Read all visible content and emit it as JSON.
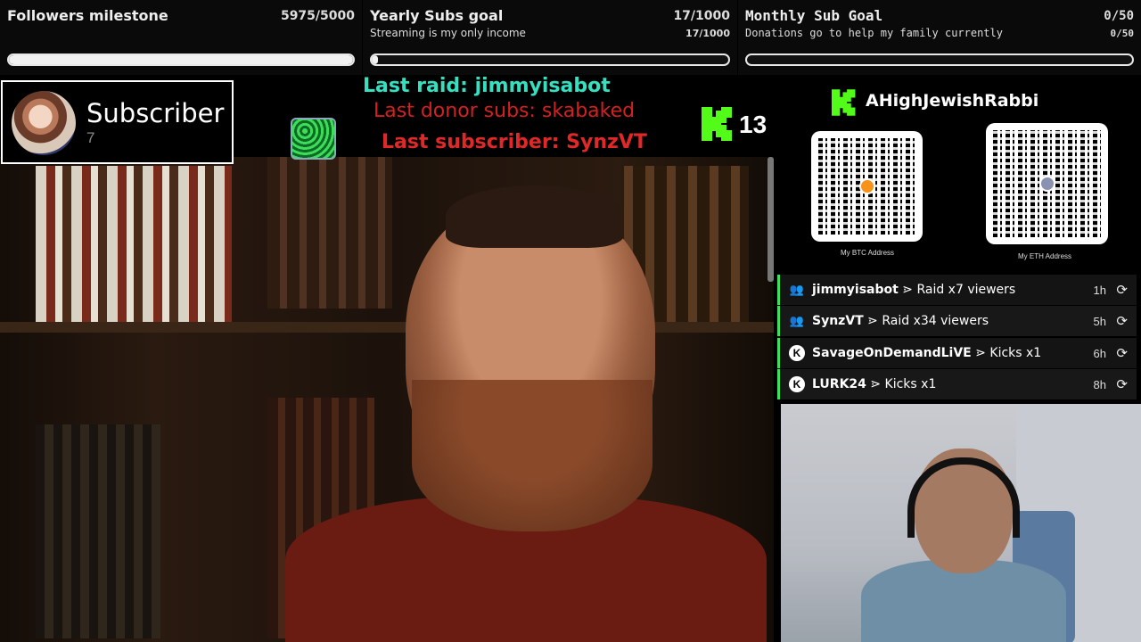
{
  "goals": [
    {
      "title": "Followers milestone",
      "count": "5975/5000",
      "subtitle": "",
      "count2": "",
      "progress": 1.0
    },
    {
      "title": "Yearly Subs goal",
      "count": "17/1000",
      "subtitle": "Streaming is my only income",
      "count2": "17/1000",
      "progress": 0.017
    },
    {
      "title": "Monthly Sub Goal",
      "count": "0/50",
      "subtitle": "Donations go to help my family currently",
      "count2": "0/50",
      "progress": 0.0
    }
  ],
  "subscriber_box": {
    "label": "Subscriber",
    "count": "7"
  },
  "last_raid": "Last raid: jimmyisabot",
  "last_donor": "Last donor subs: skabaked",
  "last_subscriber": "Last subscriber: SynzVT",
  "kick_viewers": "13",
  "channel_name": "AHighJewishRabbi",
  "qr_codes": [
    {
      "caption": "My BTC Address",
      "icon": "bitcoin-icon"
    },
    {
      "caption": "My ETH Address",
      "icon": "ethereum-icon"
    }
  ],
  "events": [
    {
      "icon": "raid-icon",
      "user": "jimmyisabot",
      "action": "⋗ Raid x7 viewers",
      "time": "1h"
    },
    {
      "icon": "raid-icon",
      "user": "SynzVT",
      "action": "⋗ Raid x34 viewers",
      "time": "5h"
    },
    {
      "icon": "kick-icon",
      "user": "SavageOnDemandLiVE",
      "action": "⋗ Kicks x1",
      "time": "6h"
    },
    {
      "icon": "kick-icon",
      "user": "LURK24",
      "action": "⋗ Kicks x1",
      "time": "8h"
    }
  ],
  "colors": {
    "kick_green": "#53fc18",
    "raid_text": "#35e0c0",
    "donor_text": "#d42020"
  }
}
